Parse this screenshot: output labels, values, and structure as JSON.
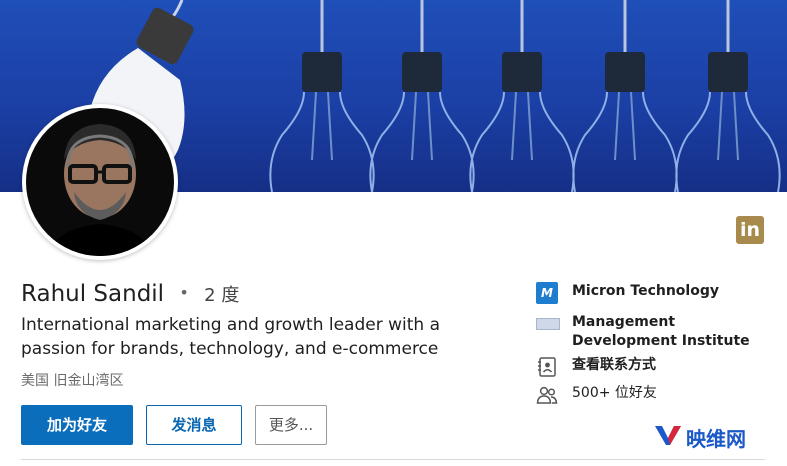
{
  "profile": {
    "name": "Rahul Sandil",
    "degree_separator": "•",
    "degree": "2 度",
    "headline": "International marketing and growth leader with a passion for brands, technology, and e-commerce",
    "location": "美国 旧金山湾区"
  },
  "actions": {
    "connect_label": "加为好友",
    "message_label": "发消息",
    "more_label": "更多..."
  },
  "sidebar": {
    "current_company": "Micron Technology",
    "education": "Management Development Institute",
    "contact_info": "查看联系方式",
    "connections": "500+ 位好友"
  },
  "badges": {
    "linkedin": "in",
    "micron_logo_text": "M"
  },
  "watermark": {
    "text": "映维网"
  },
  "colors": {
    "banner": "#1b44ac",
    "primary_button": "#0a6ebd",
    "linkedin_badge": "#a88b4c",
    "micron": "#1e7dcf"
  }
}
